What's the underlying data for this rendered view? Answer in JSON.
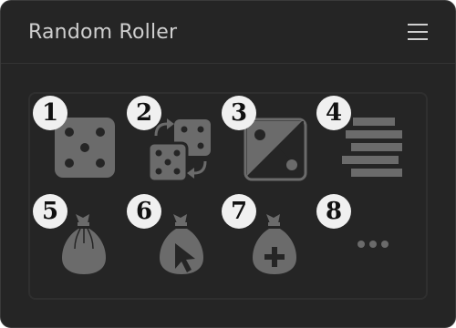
{
  "app": {
    "title": "Random Roller"
  },
  "header": {
    "menu_icon": "hamburger-menu-icon"
  },
  "tiles": [
    {
      "number": "1",
      "icon": "single-die-icon"
    },
    {
      "number": "2",
      "icon": "swap-dice-icon"
    },
    {
      "number": "3",
      "icon": "coin-flip-icon"
    },
    {
      "number": "4",
      "icon": "stacked-bars-icon"
    },
    {
      "number": "5",
      "icon": "money-bag-icon"
    },
    {
      "number": "6",
      "icon": "money-bag-cursor-icon"
    },
    {
      "number": "7",
      "icon": "money-bag-plus-icon"
    },
    {
      "number": "8",
      "icon": "more-options-icon"
    }
  ],
  "colors": {
    "background": "#252525",
    "icon": "#6b6b6b",
    "badge": "#f0f0f0",
    "title": "#cfcfcf"
  }
}
